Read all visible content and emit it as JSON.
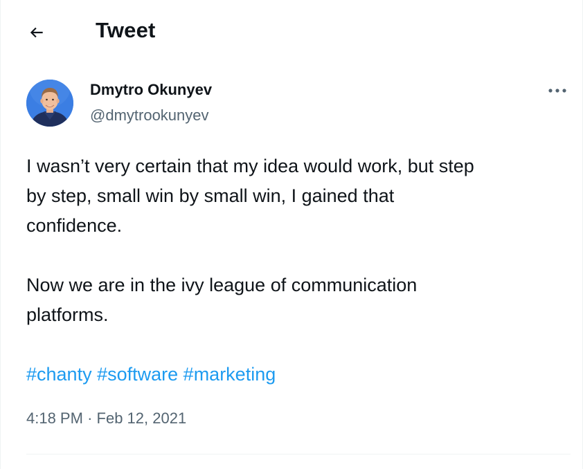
{
  "header": {
    "title": "Tweet",
    "back_icon": "arrow-left-icon"
  },
  "author": {
    "name": "Dmytro Okunyev",
    "handle": "@dmytrookunyev",
    "avatar_bg": "#3b7ee3"
  },
  "more_icon": "more-horizontal-icon",
  "tweet": {
    "lines_p1": [
      "I wasn’t very certain that my idea would work, but step",
      "by step, small win by small win, I gained that",
      "confidence."
    ],
    "lines_p2": [
      "Now we are in the ivy league of communication",
      "platforms."
    ],
    "hashtags": [
      "#chanty",
      "#software",
      "#marketing"
    ]
  },
  "timestamp": {
    "time": "4:18 PM",
    "separator": "·",
    "date": "Feb 12, 2021"
  },
  "colors": {
    "accent": "#1d9bf0",
    "text_primary": "#0f1419",
    "text_secondary": "#536471",
    "divider": "#eff3f4"
  }
}
